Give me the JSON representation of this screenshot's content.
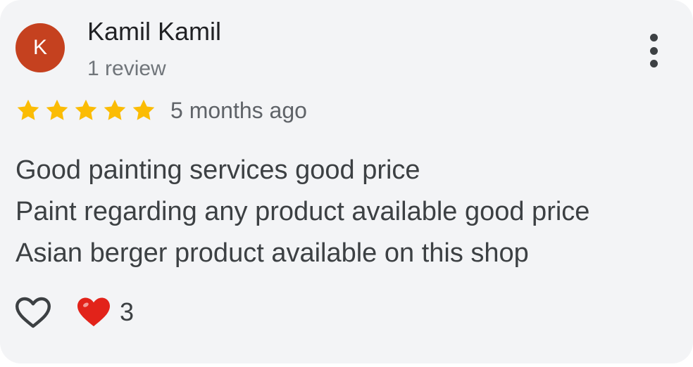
{
  "reviewer": {
    "initial": "K",
    "name": "Kamil Kamil",
    "review_count": "1 review",
    "avatar_color": "#c5411f"
  },
  "rating": {
    "stars": 5,
    "star_color": "#fbbc04",
    "time_ago": "5 months ago"
  },
  "review_text": {
    "line1": "Good painting services good price",
    "line2": "Paint regarding any product available good price",
    "line3": "Asian berger product available on this shop"
  },
  "reactions": {
    "like_icon": "heart-outline-icon",
    "reaction_icon": "red-heart-icon",
    "reaction_color": "#e2231a",
    "count": "3"
  },
  "menu_icon": "more-vert-icon"
}
